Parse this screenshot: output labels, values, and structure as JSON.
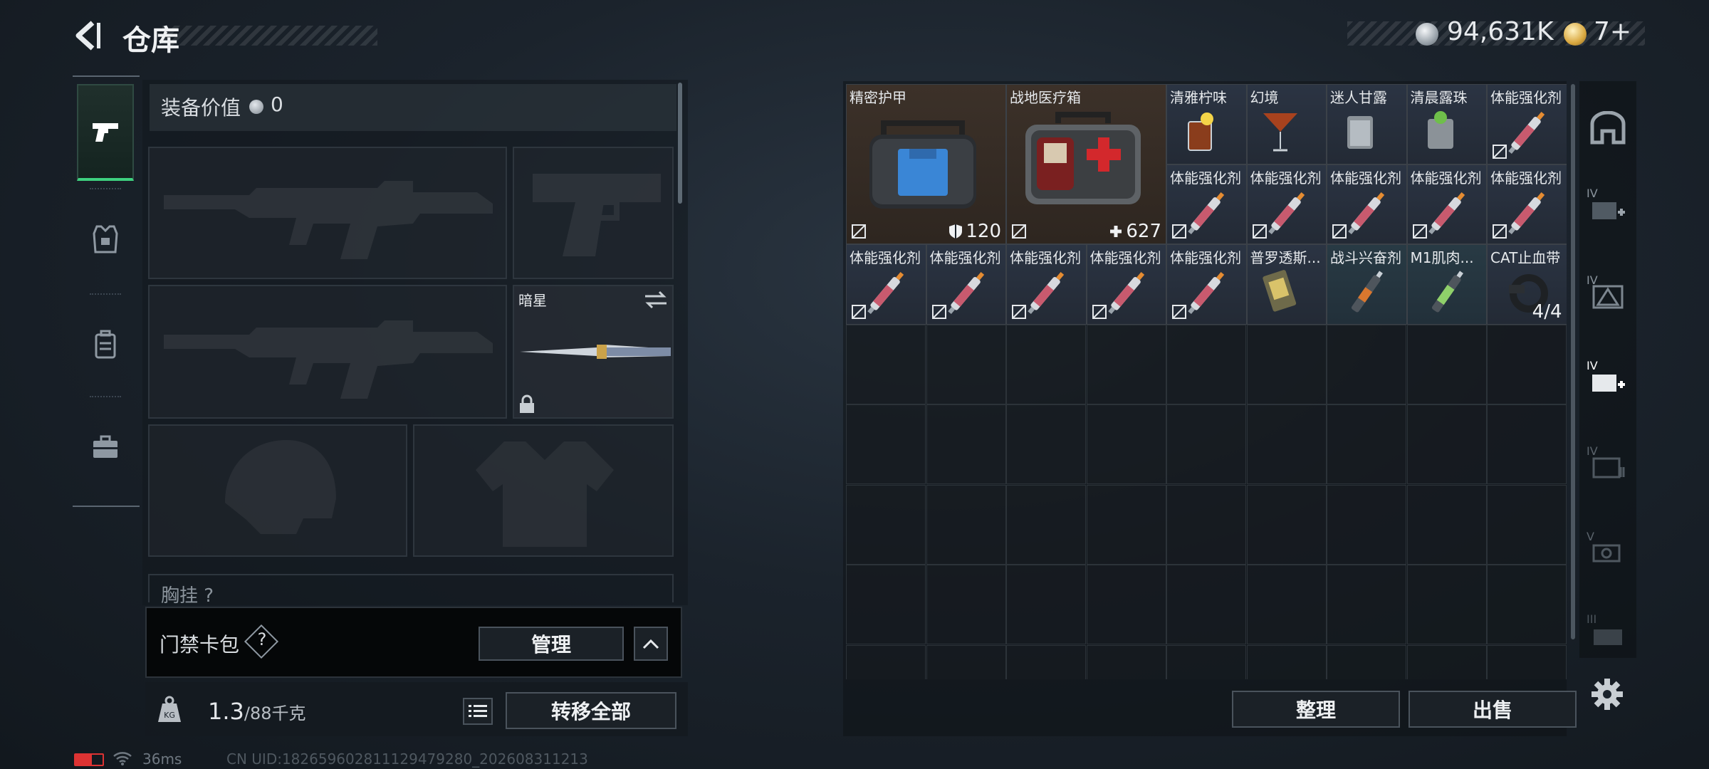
{
  "header": {
    "title": "仓库",
    "silver_amount": "94,631K",
    "ticket_amount": "7+"
  },
  "loadout": {
    "equip_value_label": "装备价值",
    "equip_value_amount": "0",
    "melee_name": "暗星",
    "chest_label": "胸挂 ?"
  },
  "access_card": {
    "label": "门禁卡包",
    "help": "?",
    "manage_label": "管理"
  },
  "bag": {
    "weight": "1.3",
    "weight_unit": "/88千克",
    "bag_badge": "KG",
    "transfer_all_label": "转移全部"
  },
  "status": {
    "ping": "36ms",
    "uid": "CN UID:1826596028111294792​80_202608311213"
  },
  "storage": {
    "items": [
      {
        "name": "精密护甲",
        "stat": "120",
        "stat_icon": "shield-icon"
      },
      {
        "name": "战地医疗箱",
        "stat": "627",
        "stat_icon": "plus-icon"
      },
      {
        "name": "清雅柠味"
      },
      {
        "name": "幻境"
      },
      {
        "name": "迷人甘露"
      },
      {
        "name": "清晨露珠"
      },
      {
        "name": "体能强化剂"
      },
      {
        "name": "体能强化剂"
      },
      {
        "name": "体能强化剂"
      },
      {
        "name": "体能强化剂"
      },
      {
        "name": "体能强化剂"
      },
      {
        "name": "体能强化剂"
      },
      {
        "name": "体能强化剂"
      },
      {
        "name": "体能强化剂"
      },
      {
        "name": "体能强化剂"
      },
      {
        "name": "体能强化剂"
      },
      {
        "name": "体能强化剂"
      },
      {
        "name": "普罗透斯..."
      },
      {
        "name": "战斗兴奋剂"
      },
      {
        "name": "M1肌肉..."
      },
      {
        "name": "CAT止血带",
        "stat": "4/4"
      }
    ],
    "sort_label": "整理",
    "sell_label": "出售"
  },
  "right_tabs": [
    "IV",
    "IV",
    "IV",
    "IV",
    "V",
    "III"
  ],
  "colors": {
    "accent_green": "#3ed17f",
    "item_blue_bg": "#2b3443",
    "item_brown_bg": "#3c3129"
  }
}
